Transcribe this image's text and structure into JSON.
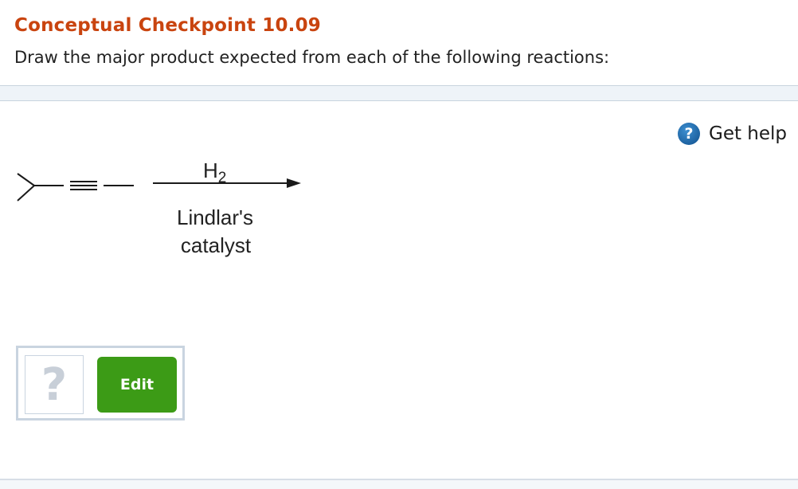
{
  "header": {
    "title": "Conceptual Checkpoint 10.09",
    "prompt": "Draw the major product expected from each of the following reactions:"
  },
  "help": {
    "icon": "question-icon",
    "label": "Get help"
  },
  "reaction": {
    "reagent": "H",
    "reagent_subscript": "2",
    "condition_line1": "Lindlar's",
    "condition_line2": "catalyst"
  },
  "answer": {
    "placeholder_symbol": "?",
    "edit_label": "Edit",
    "edit_color": "#3c9b16"
  },
  "colors": {
    "title": "#c9440f",
    "help_icon": "#1b64a8"
  }
}
